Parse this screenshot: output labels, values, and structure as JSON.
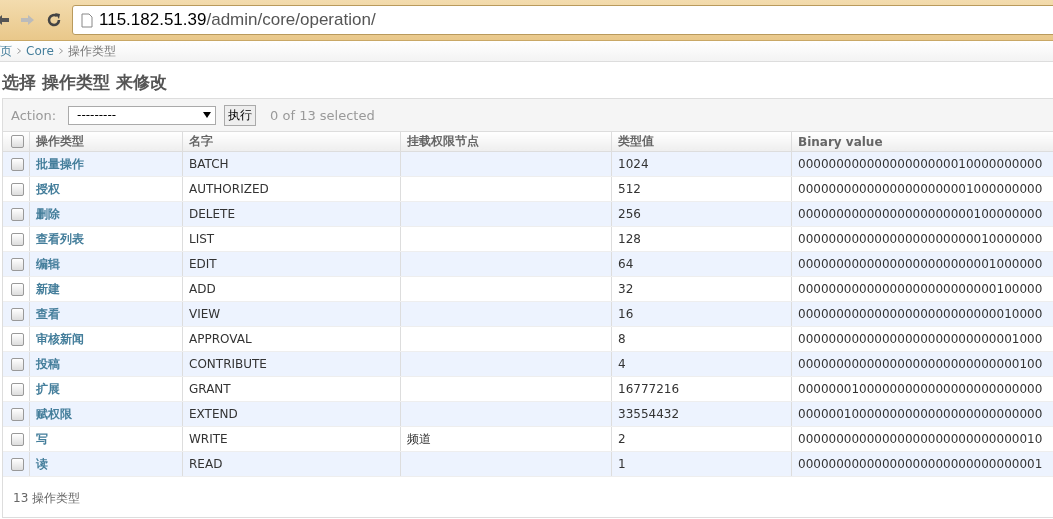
{
  "browser": {
    "url_host": "115.182.51.39",
    "url_path": "/admin/core/operation/"
  },
  "breadcrumbs": [
    {
      "label": "页",
      "link": true
    },
    {
      "label": "Core",
      "link": true
    },
    {
      "label": "操作类型",
      "link": false
    }
  ],
  "title": "选择 操作类型 来修改",
  "actions": {
    "label": "Action:",
    "select_value": "---------",
    "go_button": "执行",
    "counter": "0 of 13 selected"
  },
  "table": {
    "select_all_checked": false,
    "columns": [
      "操作类型",
      "名字",
      "挂载权限节点",
      "类型值",
      "Binary value"
    ],
    "rows": [
      {
        "checked": false,
        "cells": [
          "批量操作",
          "BATCH",
          "",
          "1024",
          "00000000000000000000010000000000"
        ]
      },
      {
        "checked": false,
        "cells": [
          "授权",
          "AUTHORIZED",
          "",
          "512",
          "00000000000000000000001000000000"
        ]
      },
      {
        "checked": false,
        "cells": [
          "删除",
          "DELETE",
          "",
          "256",
          "00000000000000000000000100000000"
        ]
      },
      {
        "checked": false,
        "cells": [
          "查看列表",
          "LIST",
          "",
          "128",
          "00000000000000000000000010000000"
        ]
      },
      {
        "checked": false,
        "cells": [
          "编辑",
          "EDIT",
          "",
          "64",
          "00000000000000000000000001000000"
        ]
      },
      {
        "checked": false,
        "cells": [
          "新建",
          "ADD",
          "",
          "32",
          "00000000000000000000000000100000"
        ]
      },
      {
        "checked": false,
        "cells": [
          "查看",
          "VIEW",
          "",
          "16",
          "00000000000000000000000000010000"
        ]
      },
      {
        "checked": false,
        "cells": [
          "审核新闻",
          "APPROVAL",
          "",
          "8",
          "00000000000000000000000000001000"
        ]
      },
      {
        "checked": false,
        "cells": [
          "投稿",
          "CONTRIBUTE",
          "",
          "4",
          "00000000000000000000000000000100"
        ]
      },
      {
        "checked": false,
        "cells": [
          "扩展",
          "GRANT",
          "",
          "16777216",
          "00000001000000000000000000000000"
        ]
      },
      {
        "checked": false,
        "cells": [
          "赋权限",
          "EXTEND",
          "",
          "33554432",
          "00000010000000000000000000000000"
        ]
      },
      {
        "checked": false,
        "cells": [
          "写",
          "WRITE",
          "频道",
          "2",
          "00000000000000000000000000000010"
        ]
      },
      {
        "checked": false,
        "cells": [
          "读",
          "READ",
          "",
          "1",
          "00000000000000000000000000000001"
        ]
      }
    ]
  },
  "paginator": "13 操作类型"
}
